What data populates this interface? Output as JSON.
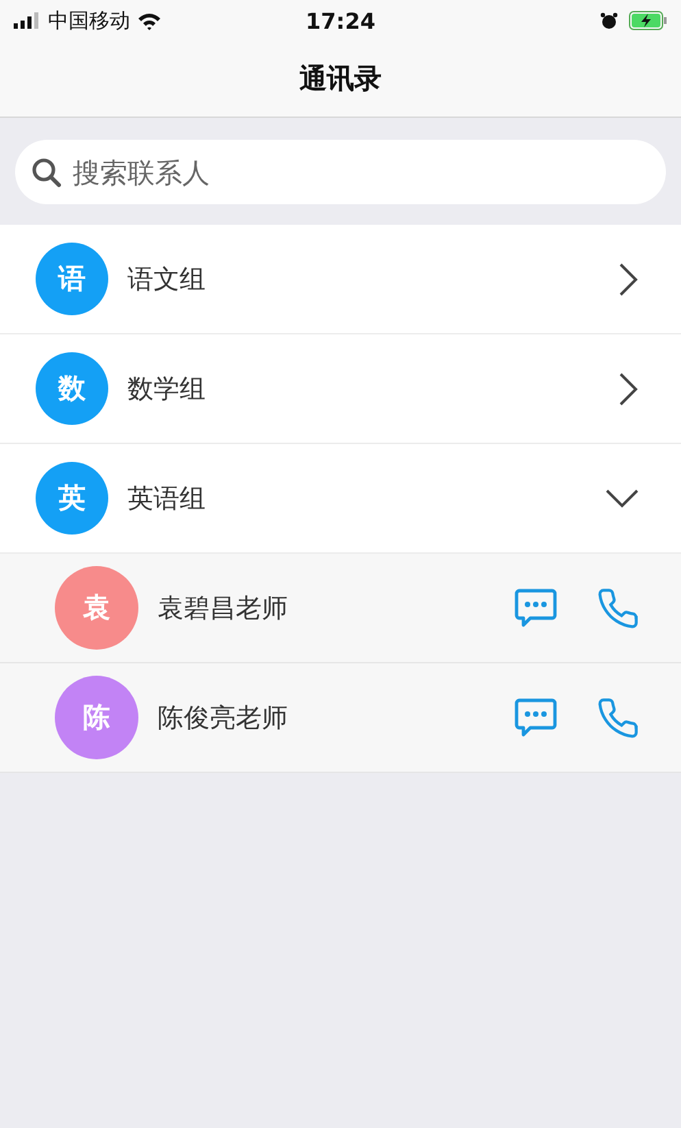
{
  "status_bar": {
    "carrier": "中国移动",
    "time": "17:24"
  },
  "nav": {
    "title": "通讯录"
  },
  "search": {
    "placeholder": "搜索联系人"
  },
  "groups": [
    {
      "initial": "语",
      "name": "语文组",
      "expanded": false
    },
    {
      "initial": "数",
      "name": "数学组",
      "expanded": false
    },
    {
      "initial": "英",
      "name": "英语组",
      "expanded": true,
      "members": [
        {
          "initial": "袁",
          "name": "袁碧昌老师",
          "color": "#f78b8b"
        },
        {
          "initial": "陈",
          "name": "陈俊亮老师",
          "color": "#c283f5"
        }
      ]
    }
  ]
}
